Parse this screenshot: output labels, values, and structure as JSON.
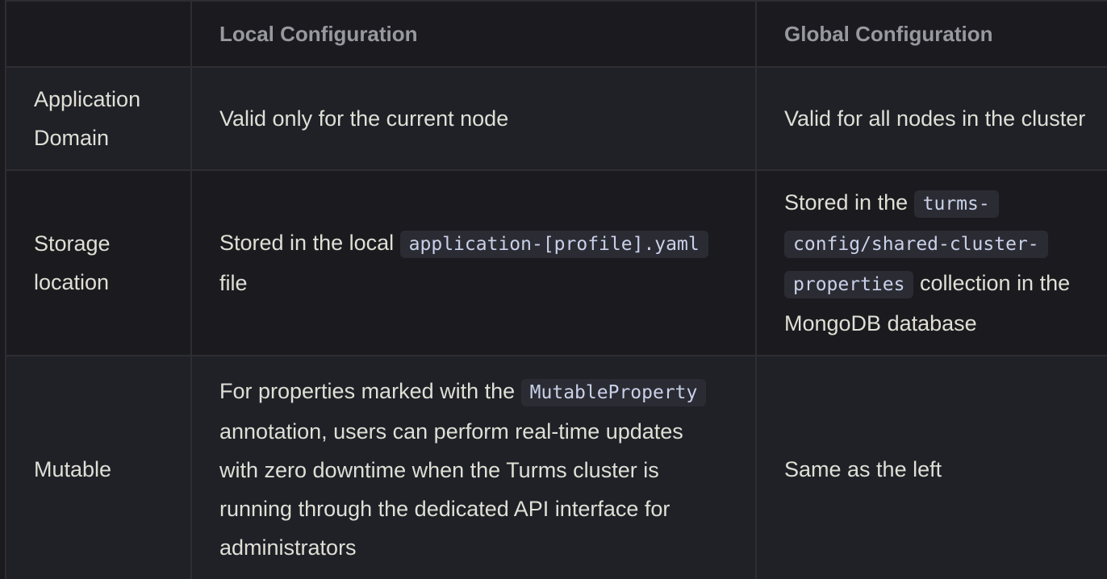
{
  "table": {
    "headers": [
      "",
      "Local Configuration",
      "Global Configuration"
    ],
    "rows": [
      {
        "label": "Application Domain",
        "local": {
          "text": "Valid only for the current node"
        },
        "global": {
          "text": "Valid for all nodes in the cluster"
        }
      },
      {
        "label": "Storage location",
        "local": {
          "before": "Stored in the local",
          "code": "application-[profile].yaml",
          "after": "file"
        },
        "global": {
          "before": "Stored in the",
          "code": "turms-config/shared-cluster-properties",
          "after": "collection in the MongoDB database"
        }
      },
      {
        "label": "Mutable",
        "local": {
          "before": "For properties marked with the",
          "code": "MutableProperty",
          "after": "annotation, users can perform real-time updates with zero downtime when the Turms cluster is running through the dedicated API interface for administrators"
        },
        "global": {
          "text": "Same as the left"
        }
      }
    ]
  }
}
